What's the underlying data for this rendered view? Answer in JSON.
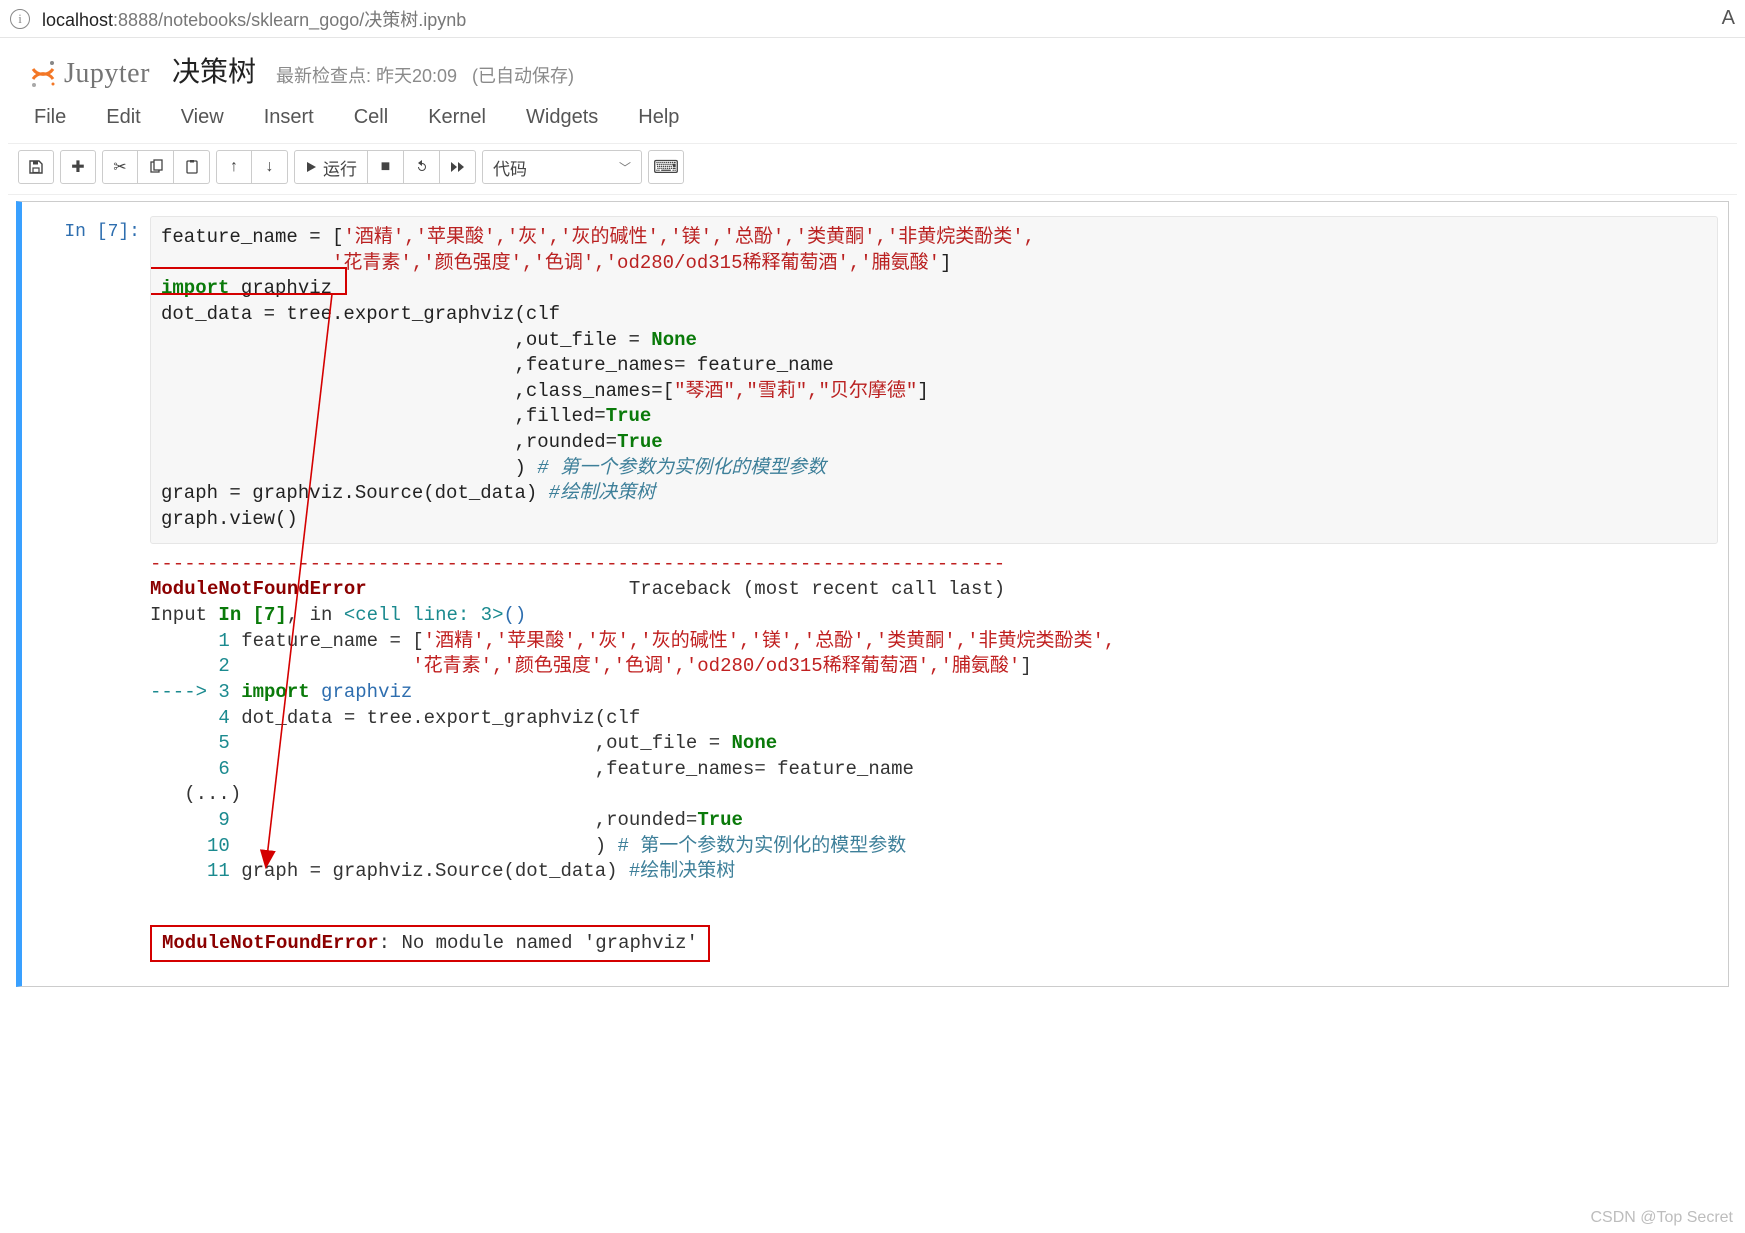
{
  "address_bar": {
    "url_host": "localhost",
    "url_rest": ":8888/notebooks/sklearn_gogo/决策树.ipynb",
    "right_char": "A"
  },
  "header": {
    "logo_text": "Jupyter",
    "nb_title": "决策树",
    "checkpoint_prefix": "最新检查点:",
    "checkpoint_time": "昨天20:09",
    "autosave": "(已自动保存)"
  },
  "menu": {
    "file": "File",
    "edit": "Edit",
    "view": "View",
    "insert": "Insert",
    "cell": "Cell",
    "kernel": "Kernel",
    "widgets": "Widgets",
    "help": "Help"
  },
  "toolbar": {
    "run_label": "运行",
    "celltype": "代码"
  },
  "cell": {
    "in_label": "In ",
    "in_num": "[7]:",
    "code": {
      "l1a": "feature_name = [",
      "l1s": "'酒精','苹果酸','灰','灰的碱性','镁','总酚','类黄酮','非黄烷类酚类',",
      "l2pad": "               ",
      "l2s": "'花青素','颜色强度','色调','od280/od315稀释葡萄酒','脯氨酸'",
      "l2b": "]",
      "l3kw": "import",
      "l3rest": " graphviz",
      "l4": "dot_data = tree.export_graphviz(clf",
      "pad": "                               ",
      "l5a": ",out_file = ",
      "l5b": "None",
      "l6": ",feature_names= feature_name",
      "l7a": ",class_names=[",
      "l7s": "\"琴酒\",\"雪莉\",\"贝尔摩德\"",
      "l7b": "]",
      "l8a": ",filled=",
      "l8b": "True",
      "l9a": ",rounded=",
      "l9b": "True",
      "l10a": ") ",
      "l10c": "# 第一个参数为实例化的模型参数",
      "l11a": "graph = graphviz.Source(dot_data) ",
      "l11c": "#绘制决策树",
      "l12": "graph.view()"
    }
  },
  "output": {
    "divider": "---------------------------------------------------------------------------",
    "err_name": "ModuleNotFoundError",
    "trace_label": "                       Traceback (most recent call last)",
    "input_label": "Input ",
    "in_label": "In [7]",
    "in_rest": ", in ",
    "cellline": "<cell line: 3>",
    "paren": "()",
    "n1": "      1",
    "l1a": " feature_name = [",
    "l1s": "'酒精','苹果酸','灰','灰的碱性','镁','总酚','类黄酮','非黄烷类酚类',",
    "n2": "      2",
    "l2pad": "                ",
    "l2s": "'花青素','颜色强度','色调','od280/od315稀释葡萄酒','脯氨酸'",
    "l2b": "]",
    "arrow": "----> 3",
    "l3a": " import",
    "l3b": " graphviz",
    "n4": "      4",
    "l4": " dot_data = tree.export_graphviz(clf",
    "n5": "      5",
    "l5a": "                                ,out_file = ",
    "l5b": "None",
    "n6": "      6",
    "l6": "                                ,feature_names= feature_name",
    "dots": "   (...)",
    "n9": "      9",
    "l9a": "                                ,rounded=",
    "l9b": "True",
    "n10": "     10",
    "l10a": "                                ) ",
    "l10c": "# 第一个参数为实例化的模型参数",
    "n11": "     11",
    "l11a": " graph = graphviz.Source(dot_data) ",
    "l11c": "#绘制决策树",
    "final_err": "ModuleNotFoundError",
    "final_msg": ": No module named 'graphviz'"
  },
  "watermark": "CSDN @Top Secret"
}
